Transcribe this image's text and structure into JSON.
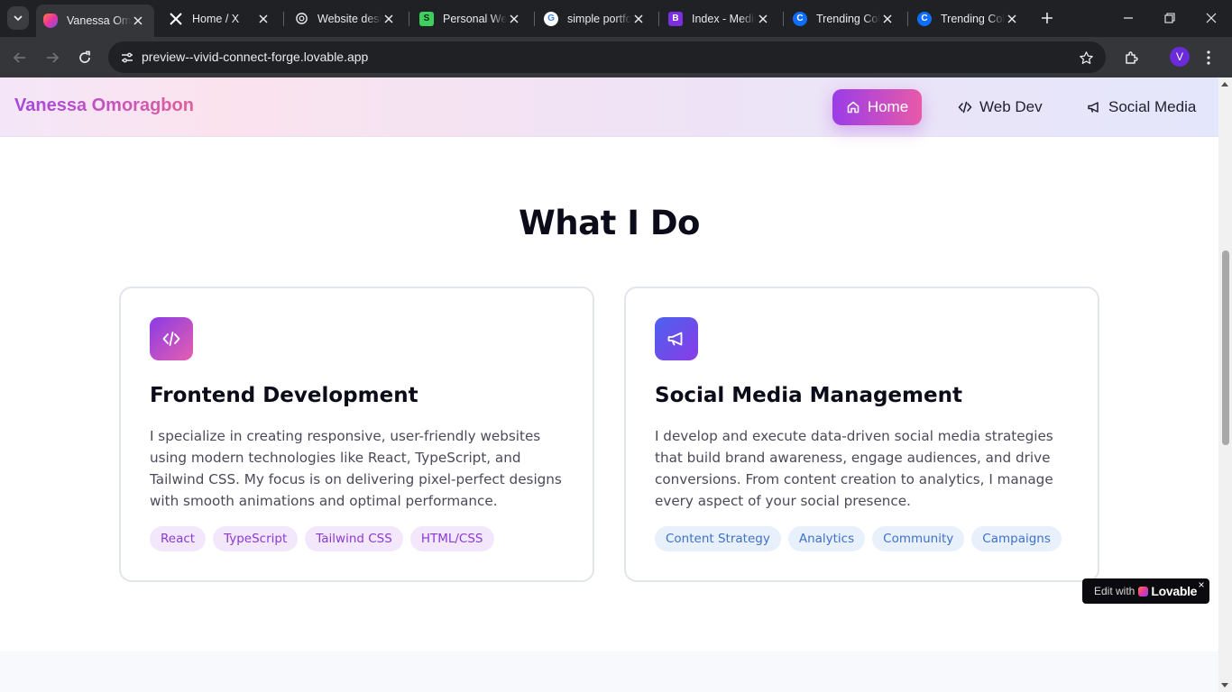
{
  "browser": {
    "tabs": [
      {
        "title": "Vanessa Omoragbon",
        "favicon": "lovable-heart-icon",
        "active": true
      },
      {
        "title": "Home / X",
        "favicon": "x-logo-icon"
      },
      {
        "title": "Website design",
        "favicon": "chatgpt-icon"
      },
      {
        "title": "Personal Website",
        "favicon": "green-app-icon"
      },
      {
        "title": "simple portfolio",
        "favicon": "google-icon"
      },
      {
        "title": "Index - Medium",
        "favicon": "bootstrap-b-icon"
      },
      {
        "title": "Trending Colors",
        "favicon": "coolors-icon"
      },
      {
        "title": "Trending Colors",
        "favicon": "coolors-icon"
      }
    ],
    "url": "preview--vivid-connect-forge.lovable.app",
    "profile_initial": "V"
  },
  "site": {
    "brand": "Vanessa Omoragbon",
    "nav": [
      {
        "label": "Home",
        "icon": "home-icon",
        "active": true
      },
      {
        "label": "Web Dev",
        "icon": "code-icon"
      },
      {
        "label": "Social Media",
        "icon": "megaphone-icon"
      }
    ]
  },
  "section": {
    "title": "What I Do",
    "cards": [
      {
        "icon": "code-icon",
        "title": "Frontend Development",
        "description": "I specialize in creating responsive, user-friendly websites using modern technologies like React, TypeScript, and Tailwind CSS. My focus is on delivering pixel-perfect designs with smooth animations and optimal performance.",
        "tags": [
          "React",
          "TypeScript",
          "Tailwind CSS",
          "HTML/CSS"
        ]
      },
      {
        "icon": "megaphone-icon",
        "title": "Social Media Management",
        "description": "I develop and execute data-driven social media strategies that build brand awareness, engage audiences, and drive conversions. From content creation to analytics, I manage every aspect of your social presence.",
        "tags": [
          "Content Strategy",
          "Analytics",
          "Community",
          "Campaigns"
        ]
      }
    ]
  },
  "badge": {
    "edit_label": "Edit with",
    "brand": "Lovable",
    "close": "×"
  },
  "colors": {
    "accent_purple": "#9b3ce8",
    "accent_pink": "#e85aa8",
    "accent_blue": "#4b62ef"
  }
}
